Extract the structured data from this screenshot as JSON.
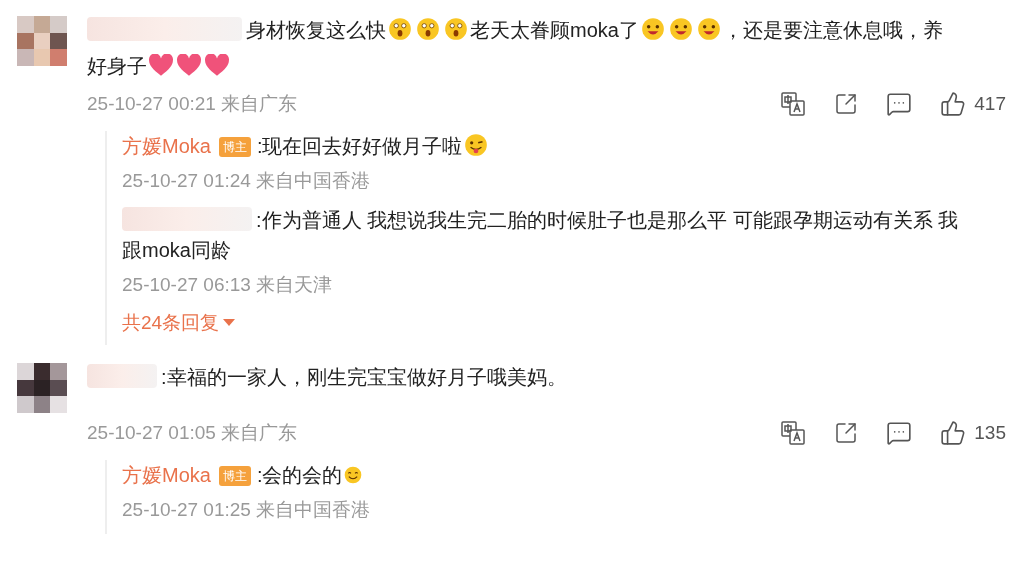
{
  "comments": [
    {
      "segments": [
        {
          "kind": "text",
          "text": "身材恢复这么快"
        },
        {
          "kind": "scream"
        },
        {
          "kind": "scream"
        },
        {
          "kind": "scream"
        },
        {
          "kind": "text",
          "text": "老天太眷顾moka了"
        },
        {
          "kind": "love"
        },
        {
          "kind": "love"
        },
        {
          "kind": "love"
        },
        {
          "kind": "text",
          "text": "，还是要注意休息哦，养"
        },
        {
          "kind": "break"
        },
        {
          "kind": "text",
          "text": "好身子"
        },
        {
          "kind": "heart"
        },
        {
          "kind": "heart"
        },
        {
          "kind": "heart"
        }
      ],
      "time": "25-10-27 00:21 来自广东",
      "likes": "417",
      "replies": [
        {
          "author": "方媛Moka",
          "badge": "博主",
          "segments": [
            {
              "kind": "text",
              "text": ":现在回去好好做月子啦"
            },
            {
              "kind": "tongue"
            }
          ],
          "time": "25-10-27 01:24 来自中国香港"
        },
        {
          "segments": [
            {
              "kind": "text",
              "text": ":作为普通人 我想说我生完二胎的时候肚子也是那么平 可能跟孕期运动有关系 我"
            },
            {
              "kind": "break"
            },
            {
              "kind": "text",
              "text": "跟moka同龄"
            }
          ],
          "time": "25-10-27 06:13 来自天津"
        }
      ],
      "more_replies": "共24条回复"
    },
    {
      "segments": [
        {
          "kind": "text",
          "text": ":幸福的一家人，刚生完宝宝做好月子哦美妈。"
        }
      ],
      "time": "25-10-27 01:05 来自广东",
      "likes": "135",
      "replies": [
        {
          "author": "方媛Moka",
          "badge": "博主",
          "segments": [
            {
              "kind": "text",
              "text": ":会的会的"
            },
            {
              "kind": "smile"
            }
          ],
          "time": "25-10-27 01:25 来自中国香港"
        }
      ]
    }
  ]
}
